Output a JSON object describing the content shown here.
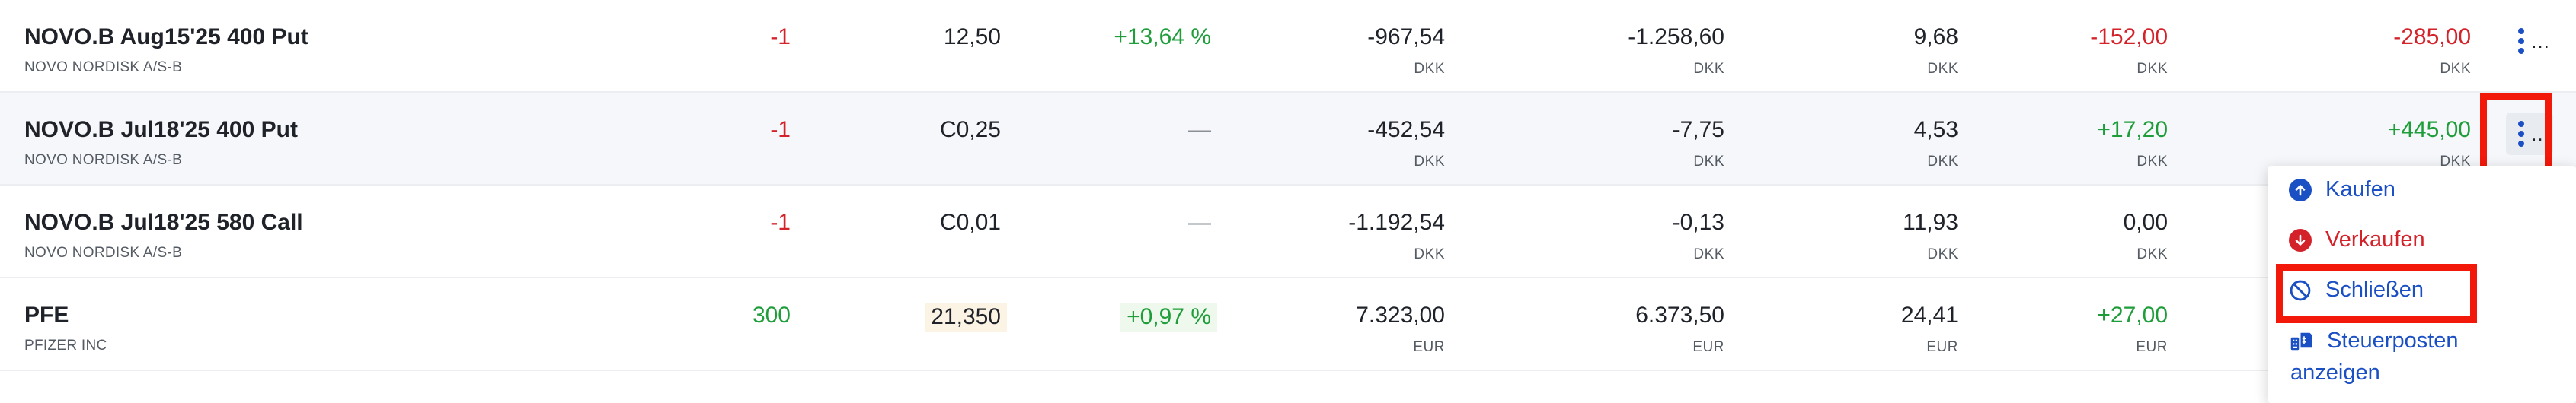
{
  "rows": [
    {
      "name": "NOVO.B Aug15'25 400 Put",
      "sub": "NOVO NORDISK A/S-B",
      "qty": "-1",
      "price": "12,50",
      "pct": "+13,64 %",
      "value": "-967,54",
      "value_cur": "DKK",
      "gl": "-1.258,60",
      "gl_cur": "DKK",
      "day": "9,68",
      "day_cur": "DKK",
      "today": "-152,00",
      "today_cur": "DKK",
      "total": "-285,00",
      "total_cur": "DKK"
    },
    {
      "name": "NOVO.B Jul18'25 400 Put",
      "sub": "NOVO NORDISK A/S-B",
      "qty": "-1",
      "price": "C0,25",
      "pct": "—",
      "value": "-452,54",
      "value_cur": "DKK",
      "gl": "-7,75",
      "gl_cur": "DKK",
      "day": "4,53",
      "day_cur": "DKK",
      "today": "+17,20",
      "today_cur": "DKK",
      "total": "+445,00",
      "total_cur": "DKK"
    },
    {
      "name": "NOVO.B Jul18'25 580 Call",
      "sub": "NOVO NORDISK A/S-B",
      "qty": "-1",
      "price": "C0,01",
      "pct": "—",
      "value": "-1.192,54",
      "value_cur": "DKK",
      "gl": "-0,13",
      "gl_cur": "DKK",
      "day": "11,93",
      "day_cur": "DKK",
      "today": "0,00",
      "today_cur": "DKK"
    },
    {
      "name": "PFE",
      "sub": "PFIZER INC",
      "qty": "300",
      "price": "21,350",
      "pct": "+0,97 %",
      "value": "7.323,00",
      "value_cur": "EUR",
      "gl": "6.373,50",
      "gl_cur": "EUR",
      "day": "24,41",
      "day_cur": "EUR",
      "today": "+27,00",
      "today_cur": "EUR"
    }
  ],
  "kebab_ellipsis": "…",
  "menu": {
    "buy": "Kaufen",
    "sell": "Verkaufen",
    "close": "Schließen",
    "tax_line1": "Steuerposten",
    "tax_line2": "anzeigen"
  },
  "colors": {
    "accent": "#1b4fc4",
    "negative": "#d3222a",
    "positive": "#1f9d3b",
    "highlight_box": "#f2180a"
  },
  "icons": [
    "arrow-up-circle-icon",
    "arrow-down-circle-icon",
    "prohibited-icon",
    "tax-document-icon",
    "kebab-menu-icon"
  ]
}
